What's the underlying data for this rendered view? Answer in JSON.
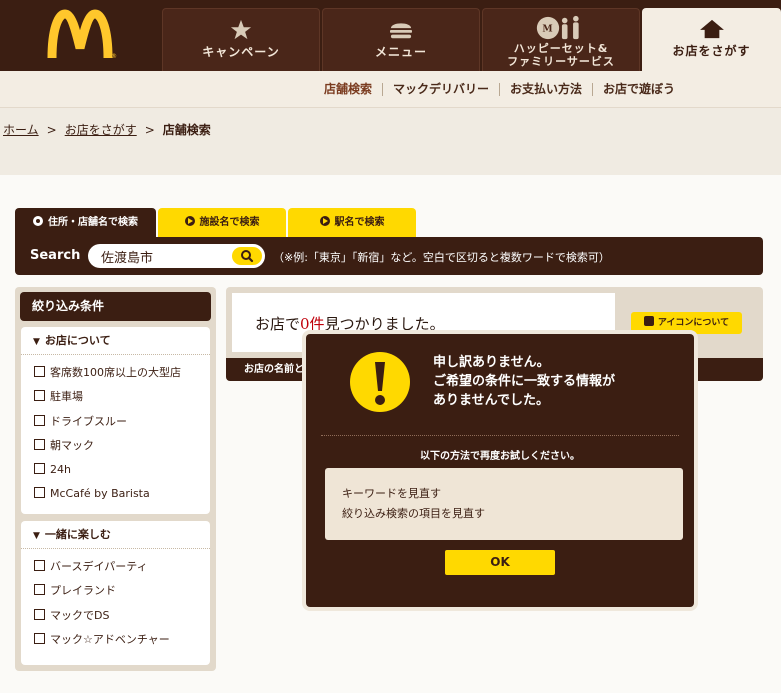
{
  "nav": {
    "tabs": [
      {
        "label": "キャンペーン",
        "icon": "star-icon"
      },
      {
        "label": "メニュー",
        "icon": "burger-icon"
      },
      {
        "label_line1": "ハッピーセット&",
        "label_line2": "ファミリーサービス",
        "icon": "family-icon"
      },
      {
        "label": "お店をさがす",
        "icon": "house-icon"
      }
    ]
  },
  "subnav": {
    "items": [
      "店舗検索",
      "マックデリバリー",
      "お支払い方法",
      "お店で遊ぼう"
    ]
  },
  "breadcrumb": {
    "home": "ホーム",
    "find_store": "お店をさがす",
    "current": "店舗検索",
    "separator": ">"
  },
  "search": {
    "tabs": [
      "住所・店舗名で検索",
      "施設名で検索",
      "駅名で検索"
    ],
    "label": "Search",
    "value": "佐渡島市",
    "hint": "（※例:「東京」「新宿」など。空白で区切ると複数ワードで検索可）"
  },
  "filters": {
    "title": "絞り込み条件",
    "groups": [
      {
        "title": "お店について",
        "items": [
          "客席数100席以上の大型店",
          "駐車場",
          "ドライブスルー",
          "朝マック",
          "24h",
          "McCafé by Barista"
        ]
      },
      {
        "title": "一緒に楽しむ",
        "items": [
          "バースデイパーティ",
          "プレイランド",
          "マックでDS",
          "マック☆アドベンチャー"
        ]
      }
    ]
  },
  "results": {
    "prefix": "お店で",
    "count": "0件",
    "suffix": "見つかりました。",
    "icon_help": "アイコンについて",
    "col_header": "お店の名前と"
  },
  "modal": {
    "title_line1": "申し訳ありません。",
    "title_line2": "ご希望の条件に一致する情報が",
    "title_line3": "ありませんでした。",
    "subtitle": "以下の方法で再度お試しください。",
    "tips": [
      "キーワードを見直す",
      "絞り込み検索の項目を見直す"
    ],
    "ok_label": "OK"
  },
  "colors": {
    "brown": "#3b1e12",
    "yellow": "#ffd900",
    "beige": "#e2d9cb",
    "red": "#c0000b"
  }
}
